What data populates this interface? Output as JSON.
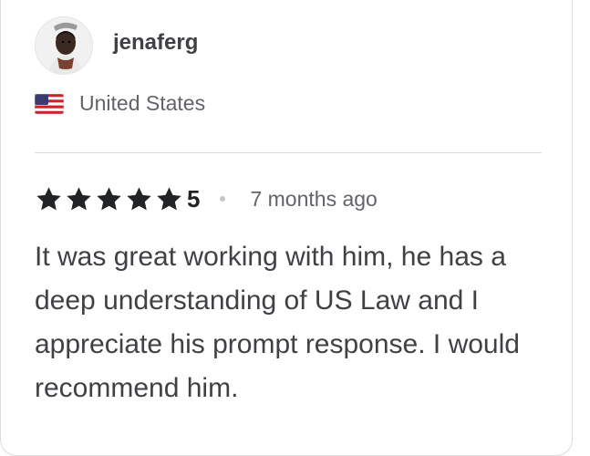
{
  "review": {
    "username": "jenaferg",
    "country": "United States",
    "rating": "5",
    "stars": 5,
    "time_ago": "7 months ago",
    "text": "It was great working with him, he has a deep understanding of US Law and I appreciate his prompt response. I would recommend him."
  },
  "icons": {
    "avatar": "user-avatar-photo",
    "flag": "us-flag-icon",
    "star": "star-icon"
  },
  "colors": {
    "star": "#222325",
    "text": "#404145",
    "muted": "#62646a",
    "divider": "#dadbdd"
  }
}
